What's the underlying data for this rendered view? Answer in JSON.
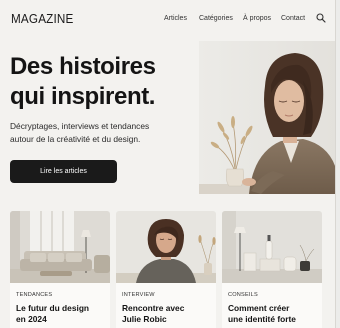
{
  "header": {
    "logo": "MAGAZINE",
    "nav": [
      "Articles",
      "Catégories",
      "À propos",
      "Contact"
    ],
    "search_icon": "search-icon"
  },
  "hero": {
    "title_line1": "Des histoires",
    "title_line2": "qui inspirent.",
    "subtitle_line1": "Décryptages, interviews et tendances",
    "subtitle_line2": "autour de la créativité et du design.",
    "cta_label": "Lire les articles"
  },
  "cards": [
    {
      "category": "TENDANCES",
      "title_line1": "Le futur du design",
      "title_line2": "en 2024"
    },
    {
      "category": "INTERVIEW",
      "title_line1": "Rencontre avec",
      "title_line2": "Julie Robic"
    },
    {
      "category": "CONSEILS",
      "title_line1": "Comment créer",
      "title_line2": "une identité forte"
    }
  ],
  "colors": {
    "background": "#f3f2ef",
    "text": "#141414",
    "button": "#1a1a1a",
    "card_body": "#fbfaf8"
  }
}
